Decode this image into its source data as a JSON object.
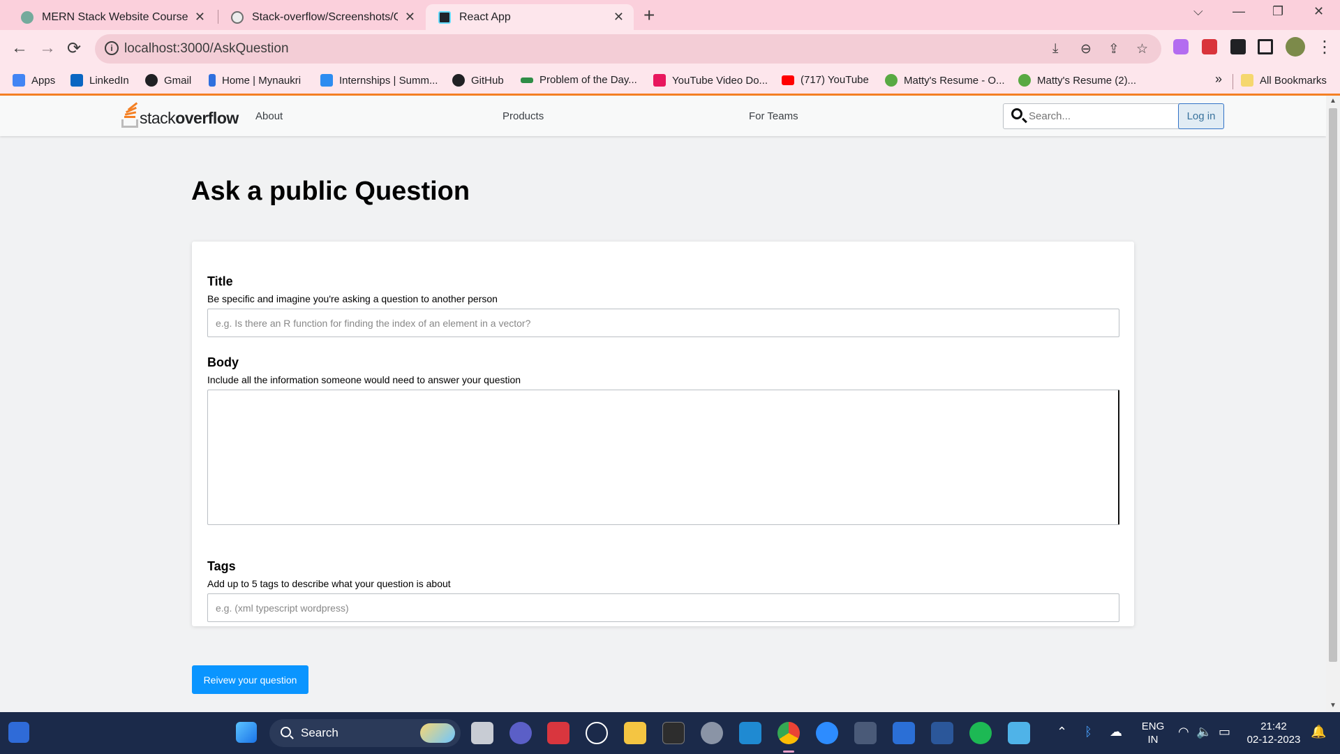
{
  "browser": {
    "tabs": [
      {
        "title": "MERN Stack Website Course",
        "close": "✕",
        "active": false
      },
      {
        "title": "Stack-overflow/Screenshots/Qu",
        "close": "✕",
        "active": false
      },
      {
        "title": "React App",
        "close": "✕",
        "active": true
      }
    ],
    "new_tab": "+",
    "window_controls": {
      "dropdown": "⌵",
      "minimize": "—",
      "restore": "❐",
      "close": "✕"
    },
    "url": "localhost:3000/AskQuestion",
    "nav": {
      "back": "←",
      "forward": "→",
      "reload": "⟳"
    },
    "bookmarks": [
      {
        "label": "Apps",
        "color": "#4285f4"
      },
      {
        "label": "LinkedIn",
        "color": "#0a66c2"
      },
      {
        "label": "Gmail",
        "color": "#202124"
      },
      {
        "label": "Home | Mynaukri",
        "color": "#2f6fde"
      },
      {
        "label": "Internships | Summ...",
        "color": "#2d8cf0"
      },
      {
        "label": "GitHub",
        "color": "#202124"
      },
      {
        "label": "Problem of the Day...",
        "color": "#2f8d46"
      },
      {
        "label": "YouTube Video Do...",
        "color": "#e8175d"
      },
      {
        "label": "(717) YouTube",
        "color": "#ff0000"
      },
      {
        "label": "Matty's Resume - O...",
        "color": "#58a942"
      },
      {
        "label": "Matty's Resume (2)...",
        "color": "#58a942"
      }
    ],
    "bookmarks_overflow": "»",
    "all_bookmarks": "All Bookmarks"
  },
  "site": {
    "logo_light": "stack",
    "logo_bold": "overflow",
    "nav_links": [
      "About",
      "Products",
      "For Teams"
    ],
    "search_placeholder": "Search...",
    "login_label": "Log in"
  },
  "ask": {
    "heading": "Ask a public Question",
    "title_label": "Title",
    "title_desc": "Be specific and imagine you're asking a question to another person",
    "title_placeholder": "e.g. Is there an R function for finding the index of an element in a vector?",
    "body_label": "Body",
    "body_desc": "Include all the information someone would need to answer your question",
    "tags_label": "Tags",
    "tags_desc": "Add up to 5 tags to describe what your question is about",
    "tags_placeholder": "e.g. (xml typescript wordpress)",
    "review_button": "Reivew your question"
  },
  "taskbar": {
    "search_label": "Search",
    "lang_line1": "ENG",
    "lang_line2": "IN",
    "time": "21:42",
    "date": "02-12-2023"
  },
  "colors": {
    "accent": "#f48024",
    "primary_button": "#0a95ff",
    "tab_bar": "#fbd0dc"
  }
}
